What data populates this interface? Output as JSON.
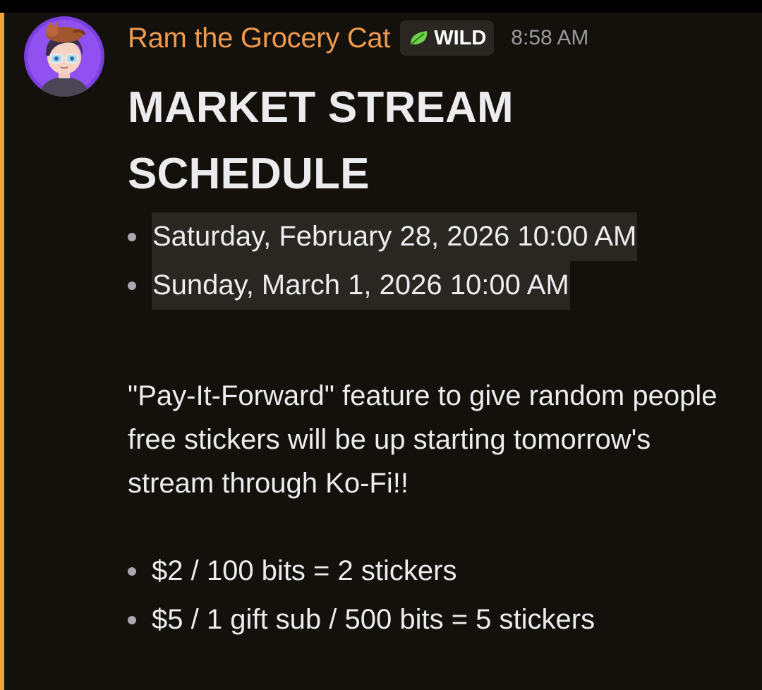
{
  "message": {
    "author": "Ram the Grocery Cat",
    "tag": {
      "label": "WILD",
      "icon": "leaf-icon"
    },
    "timestamp": "8:58 AM",
    "accent_color": "#f0a532",
    "username_color": "#ee9a4f"
  },
  "content": {
    "heading": "MARKET STREAM SCHEDULE",
    "schedule": [
      "Saturday, February 28, 2026 10:00 AM",
      "Sunday, March 1, 2026 10:00 AM"
    ],
    "paragraph": "\"Pay-It-Forward\" feature to give random people free stickers will be up starting tomorrow's stream through Ko-Fi!!",
    "prices": [
      "$2 / 100 bits = 2 stickers",
      "$5 / 1 gift sub / 500 bits = 5 stickers"
    ]
  }
}
